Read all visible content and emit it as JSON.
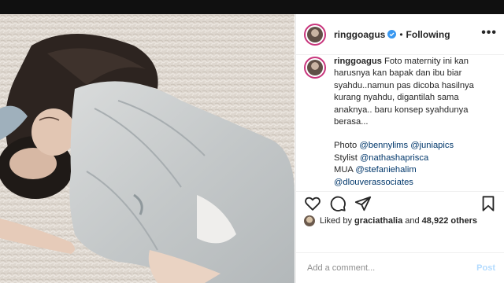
{
  "post": {
    "username": "ringgoagus",
    "follow_status": "Following",
    "separator": "•",
    "more_label": "•••"
  },
  "caption": {
    "username": "ringgoagus",
    "lines": [
      "Foto maternity ini kan",
      "harusnya kan bapak dan ibu biar",
      "syahdu..namun pas dicoba hasilnya",
      "kurang nyahdu, digantilah sama",
      "anaknya.. baru konsep syahdunya",
      "berasa..."
    ],
    "credits": [
      {
        "label": "Photo",
        "handles": "@bennylims @juniapics"
      },
      {
        "label": "Stylist",
        "handles": "@nathashaprisca"
      },
      {
        "label": "MUA",
        "handles": "@stefaniehalim"
      },
      {
        "label": "",
        "handles": "@dlouverassociates"
      }
    ]
  },
  "likes": {
    "prefix": "Liked by",
    "user": "graciathalia",
    "connector": "and",
    "others": "48,922 others"
  },
  "comment": {
    "placeholder": "Add a comment...",
    "post_label": "Post"
  },
  "icons": [
    "verified-badge-icon",
    "heart-icon",
    "comment-icon",
    "share-icon",
    "bookmark-icon",
    "more-icon"
  ],
  "colors": {
    "verified": "#3897f0",
    "story_ring": "#c8357c",
    "link": "#00376b",
    "post_disabled": "#b3dbff"
  }
}
